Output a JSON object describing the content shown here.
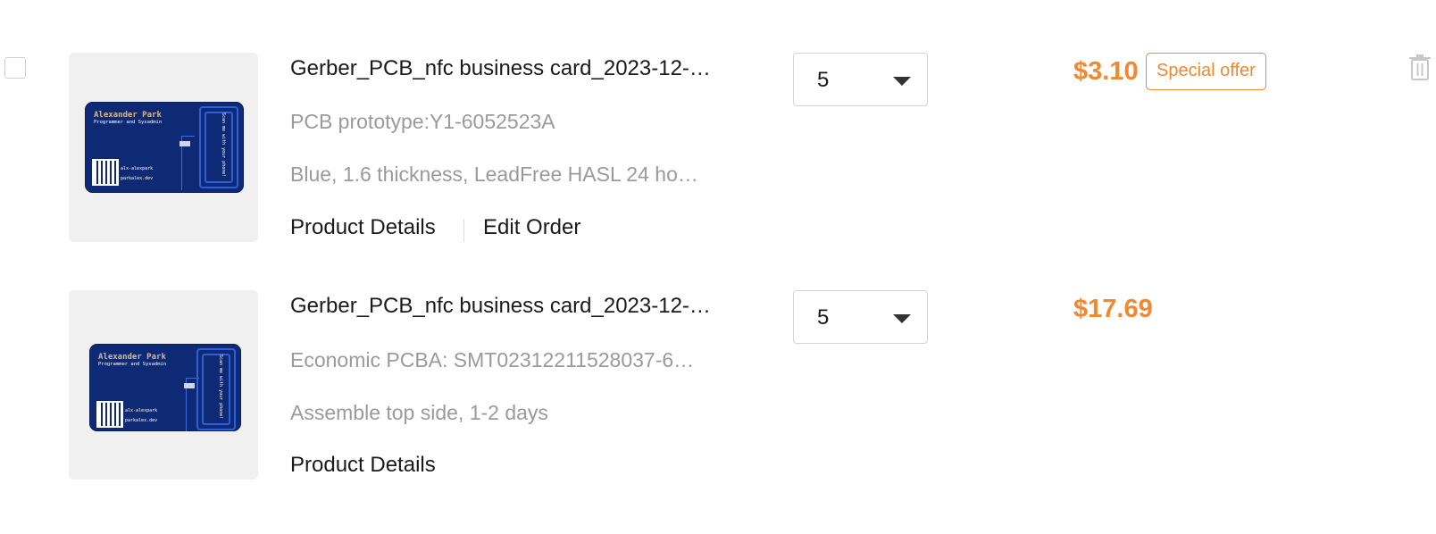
{
  "items": [
    {
      "title": "Gerber_PCB_nfc business card_2023-12-…",
      "subtitle": "PCB prototype:Y1-6052523A",
      "spec": "Blue, 1.6 thickness, LeadFree HASL 24 ho…",
      "product_details_label": "Product Details",
      "edit_order_label": "Edit Order",
      "quantity": "5",
      "price": "$3.10",
      "badge": "Special offer"
    },
    {
      "title": "Gerber_PCB_nfc business card_2023-12-…",
      "subtitle": "Economic PCBA: SMT02312211528037-6…",
      "spec": "Assemble top side, 1-2 days",
      "product_details_label": "Product Details",
      "quantity": "5",
      "price": "$17.69"
    }
  ],
  "pcb_image": {
    "name": "Alexander Park",
    "role": "Programmer and Sysadmin",
    "link_github": "alx-alexpark",
    "link_site": "parkalex.dev",
    "coil_text": "Scan me with your phone!"
  },
  "colors": {
    "accent": "#f0892f",
    "pcb_blue": "#0e2a74",
    "muted_text": "#9a9a9a"
  },
  "icons": {
    "delete": "trash-icon",
    "quantity_dropdown": "caret-down-icon"
  }
}
